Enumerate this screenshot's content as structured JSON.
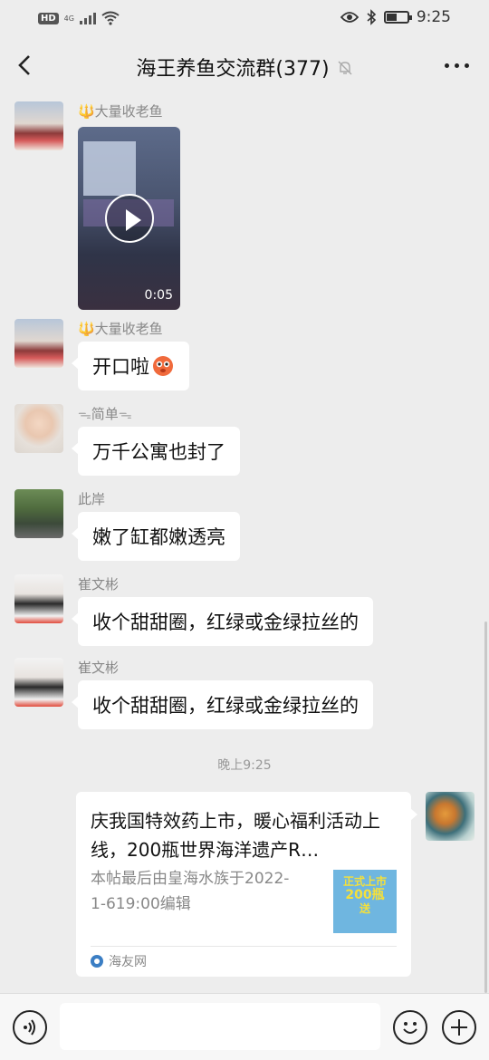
{
  "status_bar": {
    "network_badge": "HD",
    "network_type": "4G",
    "time": "9:25",
    "battery_level": 0.45
  },
  "header": {
    "title": "海王养鱼交流群(377)"
  },
  "messages": [
    {
      "sender": "🔱大量收老鱼",
      "type": "video",
      "duration": "0:05"
    },
    {
      "sender": "🔱大量收老鱼",
      "type": "text",
      "text": "开口啦"
    },
    {
      "sender": "简单",
      "type": "text",
      "text": "万千公寓也封了"
    },
    {
      "sender": "此岸",
      "type": "text",
      "text": "嫩了缸都嫩透亮"
    },
    {
      "sender": "崔文彬",
      "type": "text",
      "text": "收个甜甜圈，红绿或金绿拉丝的"
    },
    {
      "sender": "崔文彬",
      "type": "text",
      "text": "收个甜甜圈，红绿或金绿拉丝的"
    }
  ],
  "time_separator": "晚上9:25",
  "link_card": {
    "title": "庆我国特效药上市，暖心福利活动上线，200瓶世界海洋遗产R…",
    "description": "本帖最后由皇海水族于2022-1-619:00编辑",
    "thumbnail_text": [
      "正式上市",
      "200瓶",
      "送"
    ],
    "source": "海友网"
  },
  "icons": {
    "back": "chevron-left-icon",
    "mute": "bell-off-icon",
    "more": "more-horizontal-icon",
    "voice": "voice-icon",
    "emoji": "emoji-icon",
    "plus": "plus-icon"
  }
}
